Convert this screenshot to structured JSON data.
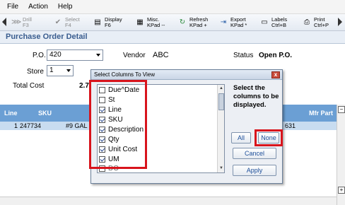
{
  "menu": {
    "items": [
      "File",
      "Action",
      "Help"
    ]
  },
  "toolbar": {
    "drill": "Drill\nF3",
    "select": "Select\nF4",
    "display": "Display\nF6",
    "misc": "Misc.\nKPad --",
    "refresh": "Refresh\nKPad +",
    "export": "Export\nKPad *",
    "labels": "Labels\nCtrl+B",
    "print": "Print\nCtrl+P"
  },
  "page": {
    "title": "Purchase Order Detail",
    "po_label": "P.O.",
    "po_value": "420",
    "vendor_label": "Vendor",
    "vendor_value": "ABC",
    "status_label": "Status",
    "status_value": "Open P.O.",
    "store_label": "Store",
    "store_value": "1",
    "total_cost_label": "Total Cost",
    "total_cost_value": "2.7"
  },
  "grid": {
    "headers": [
      "Line",
      "SKU",
      "Mfr Part"
    ],
    "row": {
      "line": "1",
      "sku": "247734",
      "desc": "#9 GAL",
      "mfr_part": "631"
    }
  },
  "dialog": {
    "title": "Select Columns To View",
    "instructions": "Select the columns to be displayed.",
    "columns": [
      {
        "label": "Due^Date",
        "checked": false
      },
      {
        "label": "St",
        "checked": false
      },
      {
        "label": "Line",
        "checked": true
      },
      {
        "label": "SKU",
        "checked": true
      },
      {
        "label": "Description",
        "checked": true
      },
      {
        "label": "Qty",
        "checked": true
      },
      {
        "label": "Unit Cost",
        "checked": true
      },
      {
        "label": "UM",
        "checked": true
      },
      {
        "label": "DO",
        "checked": false
      }
    ],
    "buttons": {
      "all": "All",
      "none": "None",
      "cancel": "Cancel",
      "apply": "Apply"
    },
    "close_glyph": "x"
  },
  "colors": {
    "header_blue": "#6b9fd4",
    "row_blue": "#c8dcf0",
    "title_blue": "#3a5d8f",
    "highlight_red": "#d8141c"
  }
}
